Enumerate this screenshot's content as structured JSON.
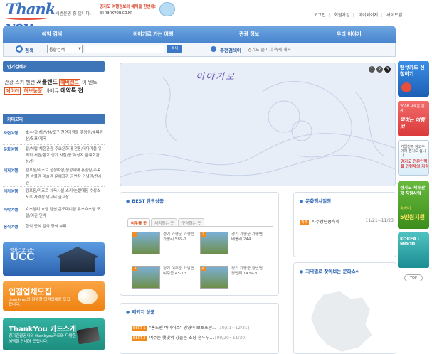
{
  "header": {
    "logo_text": "Thank you",
    "tagline": "시범운영 중 입니다.",
    "banner_line1": "경기도 여행정보와 혜택을 한번에!",
    "banner_line2": "eThankyou.co.kr",
    "links": [
      "로그인",
      "회원가입",
      "마이페이지",
      "사이트맵"
    ]
  },
  "nav": {
    "items": [
      "예약 검색",
      "이야기로 가는 여행",
      "관광 정보",
      "우리 이야기"
    ]
  },
  "search": {
    "label": "검색",
    "select_value": "통합검색",
    "button": "검색",
    "recommend_label": "추천검색어",
    "recommend_words": "경기도 물기치 축제 계곡"
  },
  "popular": {
    "title": "인기검색어",
    "words": [
      {
        "text": "관광",
        "style": "normal"
      },
      {
        "text": "스키",
        "style": "normal"
      },
      {
        "text": "펜션",
        "style": "normal"
      },
      {
        "text": "서울랜드",
        "style": "bold"
      },
      {
        "text": "에버랜드",
        "style": "hl"
      },
      {
        "text": "이",
        "style": "normal"
      },
      {
        "text": "벤트",
        "style": "normal"
      },
      {
        "text": "에이러",
        "style": "hl"
      },
      {
        "text": "허브농장",
        "style": "hl"
      },
      {
        "text": "바베큐",
        "style": "normal"
      },
      {
        "text": "예약특",
        "style": "bold"
      },
      {
        "text": "전",
        "style": "bold"
      }
    ]
  },
  "category": {
    "title": "카테고리",
    "rows": [
      {
        "name": "자연여행",
        "items": "호수/강 해변/섬/포구 천연기념물 휴양림/수목원 산/폭포/계곡"
      },
      {
        "name": "문화여행",
        "items": "탑/석탑 체험관광 주요문화재 전통/테마마을 유적지 서원/향교 생가 사찰/종교/성지 문예회관 농/장"
      },
      {
        "name": "레저여행",
        "items": "캠프장/리조트 청정여행/청정지대 휴양림/수목원 박물관 미술관 문예회관 공연장 기념관/전시관"
      },
      {
        "name": "레저여행",
        "items": "캠프장/리조트 체육시설 스키/눈썰매장 수상스포츠 사격장 낚시터 골프장"
      },
      {
        "name": "숙박여행",
        "items": "호스텔리 호텔 펜션 콘도미니엄 유스호스텔 모텔/여관 민박"
      },
      {
        "name": "음식여행",
        "items": "한식 중식 일식 양식 부페"
      }
    ]
  },
  "banners": {
    "ucc_small": "영상으로 보는",
    "ucc_big": "UCC",
    "event_title": "입점업체모집",
    "event_desc": "thankyou와 함께할 입점업체를 모집합니다.",
    "card_title": "ThankYou 카드스개",
    "card_desc": "경기관광공사의 thankyou카드와 다양한 혜택을 안내해 드립니다."
  },
  "hero": {
    "title": "이야기로",
    "pages": [
      "1",
      "2",
      "3"
    ],
    "active_page": "3"
  },
  "best": {
    "title": "BEST 관광상품",
    "tabs": [
      "여우를 곳",
      "체험하는 곳",
      "구경하는 곳"
    ],
    "items": [
      {
        "n": "1",
        "text": "경기 가평군 가평읍 가평리 585-1"
      },
      {
        "n": "2",
        "text": "경기 가평군 가평면 태봉리 244"
      },
      {
        "n": "3",
        "text": "경기 여주군 가남면 여주읍 45-13"
      },
      {
        "n": "4",
        "text": "경기 가평군 경반면 경반리 1439-3"
      }
    ]
  },
  "package": {
    "title": "패키지 상품",
    "rows": [
      {
        "badge": "BEST 1",
        "text": "\"홈드맨 바이러스\" 영영파 뽀뽀프랑...",
        "date": "[10/01~12/31]"
      },
      {
        "badge": "BEST 2",
        "text": "여주는 햇빛의 강물은 초당 순두부...",
        "date": "[09/20~11/30]"
      }
    ]
  },
  "festival": {
    "title": "문화행사일정",
    "badge": "축제",
    "name": "파주장단콩축제",
    "date": "11/21~11/23"
  },
  "map": {
    "title": "지역별로 찾아보는 문화소식"
  },
  "side_ads": {
    "ad1": "땡큐카드 신청하기",
    "ad2_small": "2008 새로운 관광",
    "ad2_big": "찍히는 여행지",
    "ad3_small": "기업전주 참고추 이제 땡기도 쉽니다",
    "ad3_big": "경기도 전문인력을 인턴제의 지원",
    "ad4_title": "경기도 체류관광 지원사업",
    "ad4_sub": "숙박비",
    "ad4_amount": "5만원지원",
    "ad5": "KOREA · MOOD",
    "top": "TOP"
  }
}
